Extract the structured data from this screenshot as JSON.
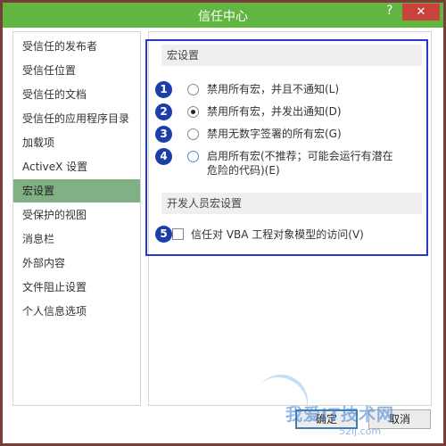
{
  "window": {
    "title": "信任中心",
    "help_glyph": "?",
    "close_glyph": "✕"
  },
  "sidebar": {
    "items": [
      {
        "label": "受信任的发布者"
      },
      {
        "label": "受信任位置"
      },
      {
        "label": "受信任的文档"
      },
      {
        "label": "受信任的应用程序目录"
      },
      {
        "label": "加载项"
      },
      {
        "label": "ActiveX 设置"
      },
      {
        "label": "宏设置"
      },
      {
        "label": "受保护的视图"
      },
      {
        "label": "消息栏"
      },
      {
        "label": "外部内容"
      },
      {
        "label": "文件阻止设置"
      },
      {
        "label": "个人信息选项"
      }
    ],
    "active_index": 6
  },
  "macro_settings": {
    "heading": "宏设置",
    "options": [
      {
        "badge": "1",
        "label": "禁用所有宏，并且不通知(L)",
        "checked": false
      },
      {
        "badge": "2",
        "label": "禁用所有宏，并发出通知(D)",
        "checked": true
      },
      {
        "badge": "3",
        "label": "禁用无数字签署的所有宏(G)",
        "checked": false
      },
      {
        "badge": "4",
        "label": "启用所有宏(不推荐；可能会运行有潜在危险的代码)(E)",
        "checked": false
      }
    ]
  },
  "developer_settings": {
    "heading": "开发人员宏设置",
    "badge": "5",
    "checkbox_label": "信任对 VBA 工程对象模型的访问(V)",
    "checked": false
  },
  "footer": {
    "ok_label": "确定",
    "cancel_label": "取消"
  },
  "watermark": {
    "text": "我爱IT技术网",
    "sub": "52ij.com"
  },
  "colors": {
    "titlebar": "#61b541",
    "active_nav": "#7fb185",
    "highlight_border": "#2639c9",
    "badge": "#1b3ea8",
    "close_button": "#c9433c"
  }
}
